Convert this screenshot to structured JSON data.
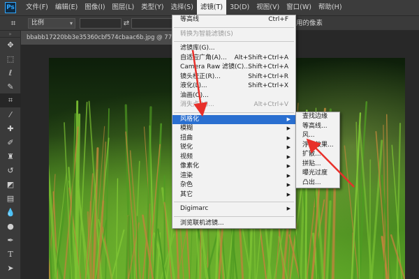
{
  "app": {
    "logo": "Ps"
  },
  "menubar": {
    "items": [
      "文件(F)",
      "编辑(E)",
      "图像(I)",
      "图层(L)",
      "类型(Y)",
      "选择(S)",
      "滤镜(T)",
      "3D(D)",
      "视图(V)",
      "窗口(W)",
      "帮助(H)"
    ],
    "active": "滤镜(T)"
  },
  "options": {
    "ratio_label": "比例",
    "tail_text": "用的像素"
  },
  "document": {
    "tab_title": "bbabb17220bb3e35360cbf574cbaac6b.jpg @ 77.1% (x_la"
  },
  "filter_menu": {
    "groups": [
      [
        {
          "label": "等高线",
          "shortcut": "Ctrl+F",
          "disabled": false
        }
      ],
      [
        {
          "label": "转换为智能滤镜(S)",
          "shortcut": "",
          "disabled": true
        }
      ],
      [
        {
          "label": "滤镜库(G)...",
          "shortcut": "",
          "disabled": false
        },
        {
          "label": "自适应广角(A)...",
          "shortcut": "Alt+Shift+Ctrl+A",
          "disabled": false
        },
        {
          "label": "Camera Raw 滤镜(C)...",
          "shortcut": "Shift+Ctrl+A",
          "disabled": false
        },
        {
          "label": "镜头校正(R)...",
          "shortcut": "Shift+Ctrl+R",
          "disabled": false
        },
        {
          "label": "液化(L)...",
          "shortcut": "Shift+Ctrl+X",
          "disabled": false
        },
        {
          "label": "油画(O)...",
          "shortcut": "",
          "disabled": false
        },
        {
          "label": "消失点(V)...",
          "shortcut": "Alt+Ctrl+V",
          "disabled": true
        }
      ],
      [
        {
          "label": "风格化",
          "submenu": true,
          "highlighted": true
        },
        {
          "label": "模糊",
          "submenu": true
        },
        {
          "label": "扭曲",
          "submenu": true
        },
        {
          "label": "锐化",
          "submenu": true
        },
        {
          "label": "视频",
          "submenu": true
        },
        {
          "label": "像素化",
          "submenu": true
        },
        {
          "label": "渲染",
          "submenu": true
        },
        {
          "label": "杂色",
          "submenu": true
        },
        {
          "label": "其它",
          "submenu": true
        }
      ],
      [
        {
          "label": "Digimarc",
          "submenu": true
        }
      ],
      [
        {
          "label": "浏览联机滤镜...",
          "shortcut": ""
        }
      ]
    ]
  },
  "stylize_submenu": {
    "items": [
      "查找边缘",
      "等高线...",
      "风...",
      "浮雕效果...",
      "扩散...",
      "拼贴...",
      "曝光过度",
      "凸出..."
    ]
  },
  "colors": {
    "menu_bg": "#f2f2f2",
    "highlight": "#2a6fd0",
    "annotation_arrow": "#e8302a",
    "ui_dark": "#3c3c3c"
  }
}
